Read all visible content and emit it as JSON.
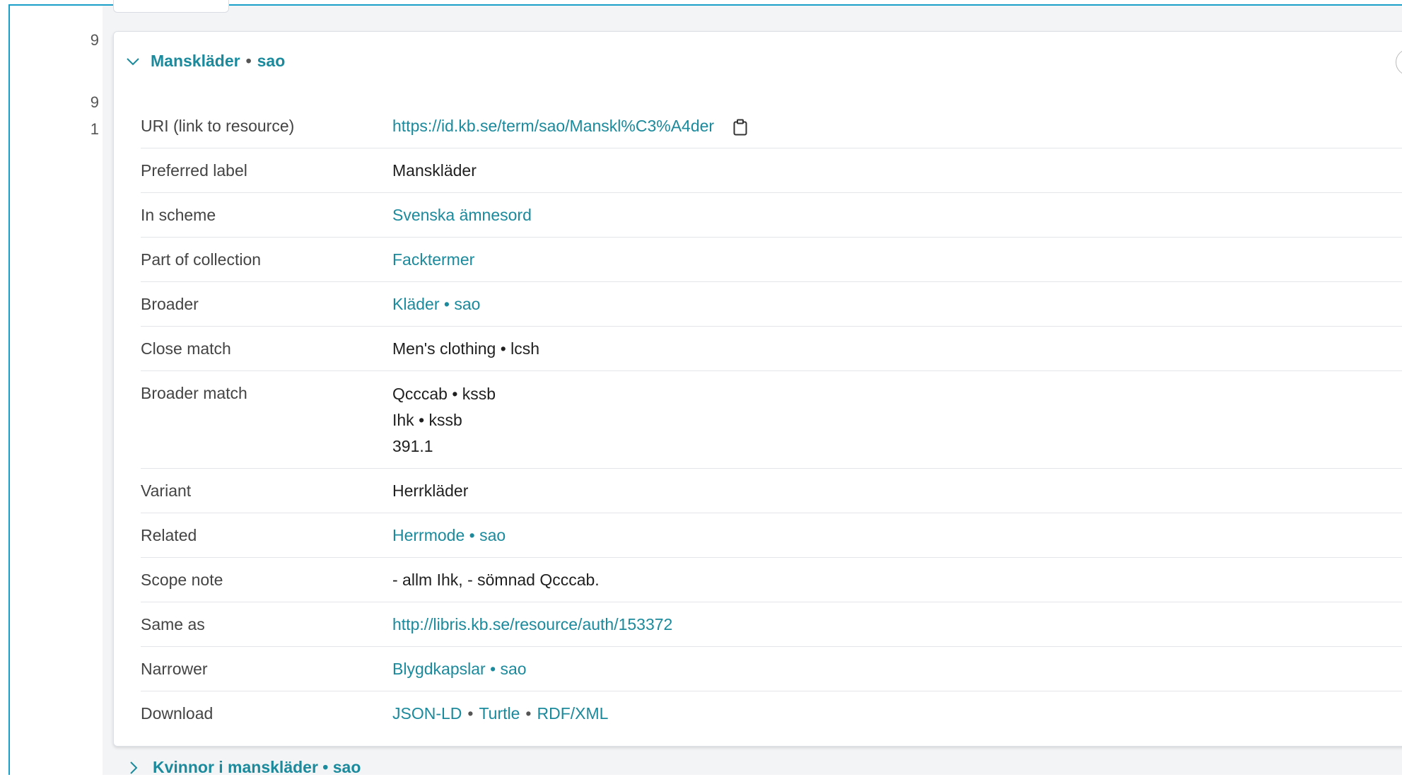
{
  "gutter": {
    "numbers": [
      "9",
      "9",
      "1"
    ]
  },
  "card": {
    "header_term": "Manskläder",
    "header_sep": "•",
    "header_scheme": "sao"
  },
  "rows": {
    "uri": {
      "label": "URI (link to resource)",
      "value": "https://id.kb.se/term/sao/Manskl%C3%A4der"
    },
    "preferred": {
      "label": "Preferred label",
      "value": "Manskläder"
    },
    "scheme": {
      "label": "In scheme",
      "value": "Svenska ämnesord"
    },
    "collection": {
      "label": "Part of collection",
      "value": "Facktermer"
    },
    "broader": {
      "label": "Broader",
      "value": "Kläder • sao"
    },
    "close": {
      "label": "Close match",
      "value": "Men's clothing • lcsh"
    },
    "broader_match": {
      "label": "Broader match",
      "values": [
        "Qcccab • kssb",
        "Ihk • kssb",
        "391.1"
      ]
    },
    "variant": {
      "label": "Variant",
      "value": "Herrkläder"
    },
    "related": {
      "label": "Related",
      "value": "Herrmode • sao"
    },
    "scope": {
      "label": "Scope note",
      "value": "- allm Ihk, - sömnad Qcccab."
    },
    "same_as": {
      "label": "Same as",
      "value": "http://libris.kb.se/resource/auth/153372"
    },
    "narrower": {
      "label": "Narrower",
      "value": "Blygdkapslar • sao"
    },
    "download": {
      "label": "Download",
      "formats": [
        "JSON-LD",
        "Turtle",
        "RDF/XML"
      ],
      "sep": "•"
    }
  },
  "next_item": {
    "label": "Kvinnor i manskläder • sao"
  },
  "icons": {
    "expand": "chevron-down-icon",
    "collapse": "chevron-right-icon",
    "copy": "clipboard-icon"
  },
  "colors": {
    "accent": "#1b8a9c",
    "frame": "#1aa0c8"
  }
}
